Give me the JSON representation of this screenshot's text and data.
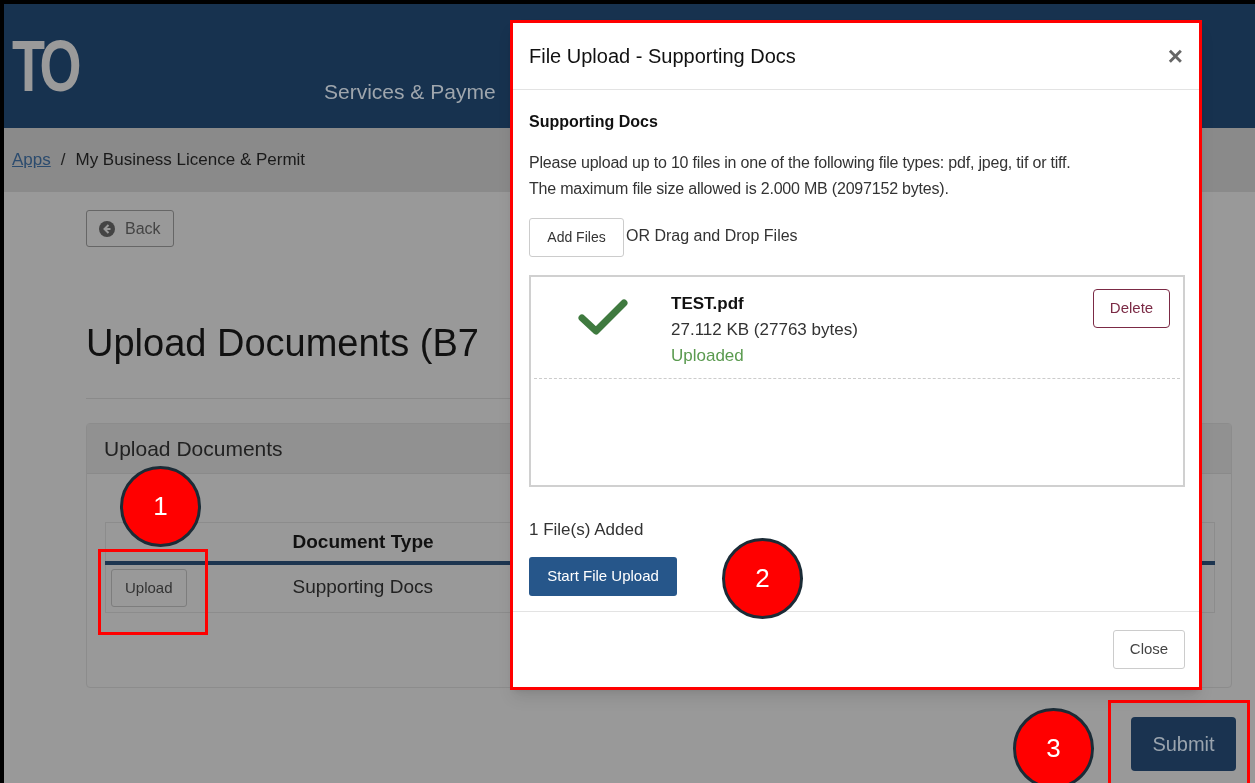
{
  "header": {
    "logo": "TO",
    "title": "Services & Payme"
  },
  "breadcrumb": {
    "link": "Apps",
    "separator": "/",
    "current": "My Business Licence & Permit"
  },
  "back_button": "Back",
  "page_title": "Upload Documents (B7",
  "card": {
    "title": "Upload Documents",
    "table": {
      "columns": [
        "Document Type"
      ],
      "rows": [
        {
          "action": "Upload",
          "document_type": "Supporting Docs"
        }
      ]
    }
  },
  "submit_button": "Submit",
  "modal": {
    "title": "File Upload - Supporting Docs",
    "close_icon": "×",
    "section_title": "Supporting Docs",
    "description": [
      "Please upload up to 10 files in one of the following file types: pdf, jpeg, tif or tiff.",
      "The maximum file size allowed is 2.000 MB (2097152 bytes)."
    ],
    "add_files_button": "Add Files",
    "drop_hint": "OR Drag and Drop Files",
    "files": [
      {
        "name": "TEST.pdf",
        "size": "27.112 KB (27763 bytes)",
        "status": "Uploaded",
        "uploaded": true,
        "delete_button": "Delete"
      }
    ],
    "count": "1 File(s) Added",
    "start_button": "Start File Upload",
    "close_button": "Close"
  },
  "callouts": [
    "1",
    "2",
    "3"
  ]
}
